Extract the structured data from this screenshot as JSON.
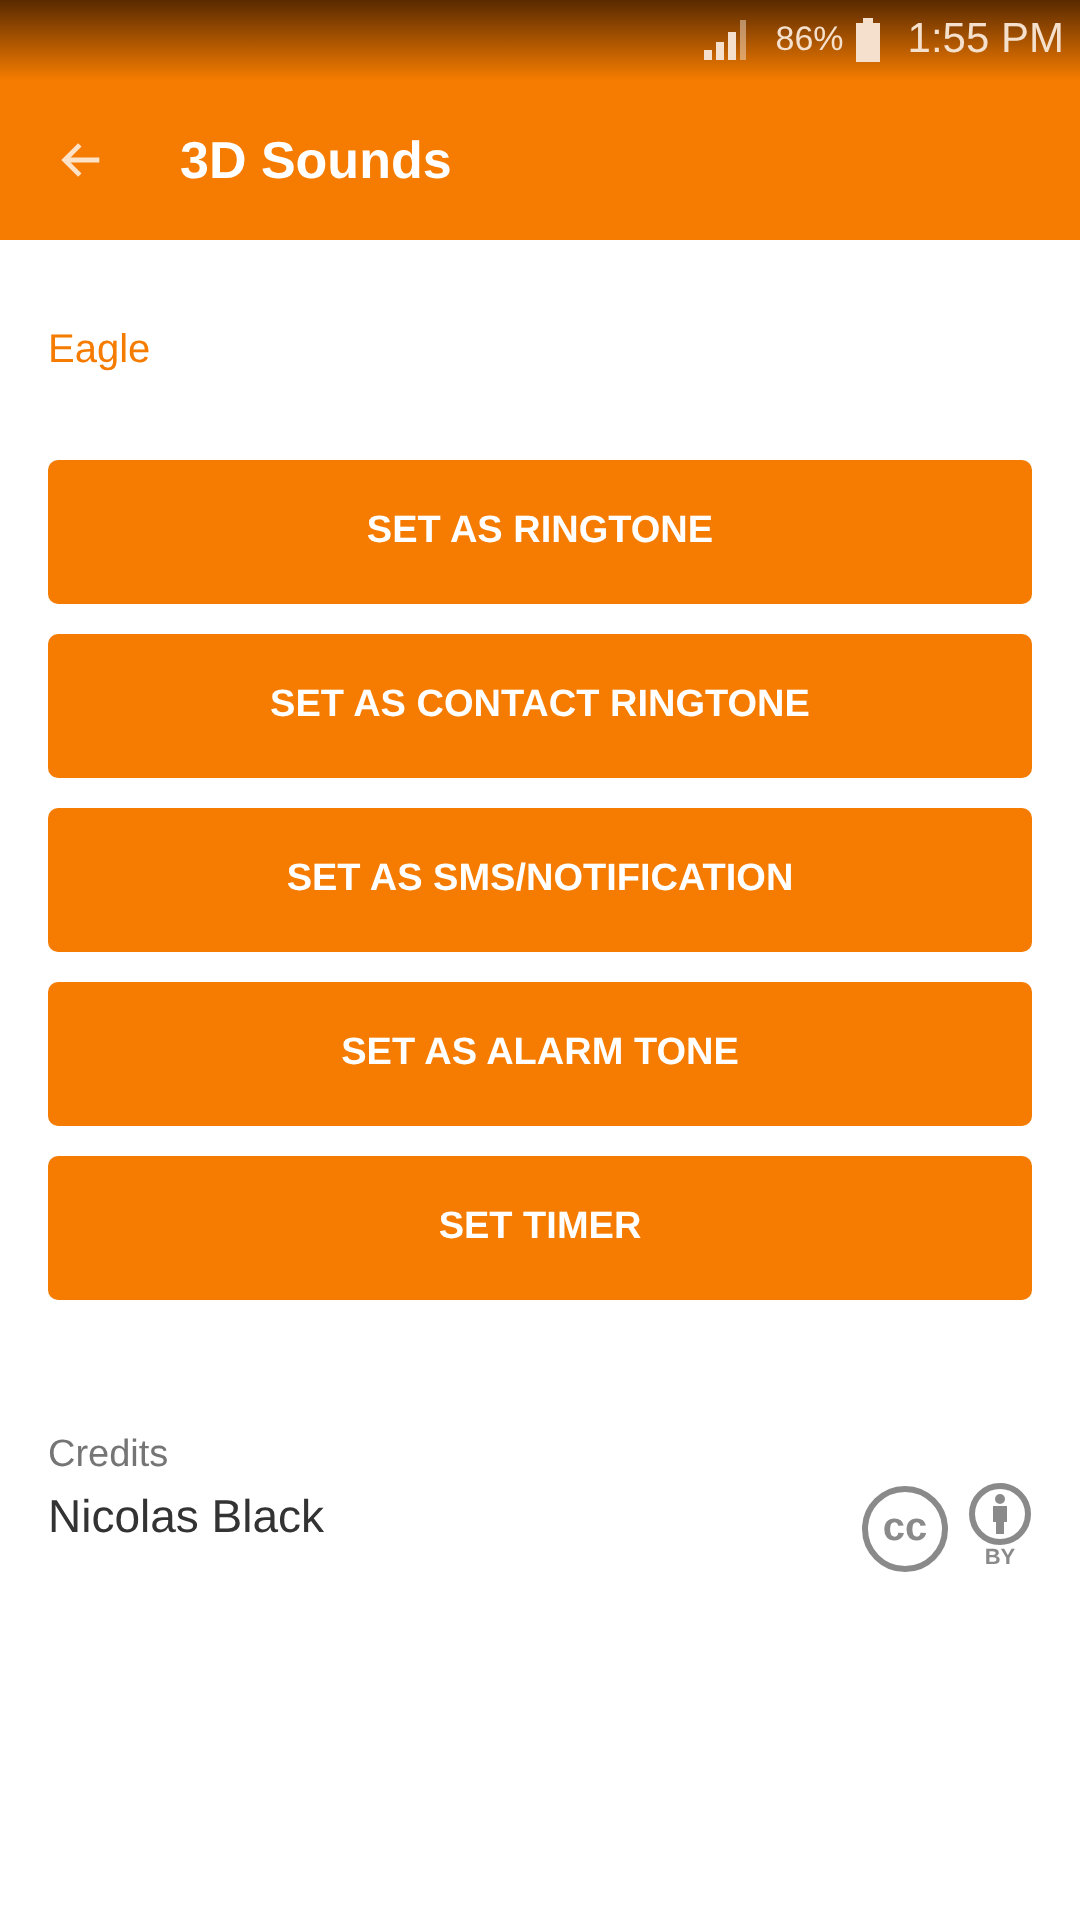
{
  "status_bar": {
    "battery_text": "86%",
    "time": "1:55 PM"
  },
  "app_bar": {
    "title": "3D Sounds"
  },
  "sound_name": "Eagle",
  "buttons": [
    "SET AS RINGTONE",
    "SET AS CONTACT RINGTONE",
    "SET AS SMS/NOTIFICATION",
    "SET AS ALARM TONE",
    "SET TIMER"
  ],
  "credits": {
    "label": "Credits",
    "author": "Nicolas Black",
    "license_mark": "cc",
    "license_by": "BY"
  }
}
